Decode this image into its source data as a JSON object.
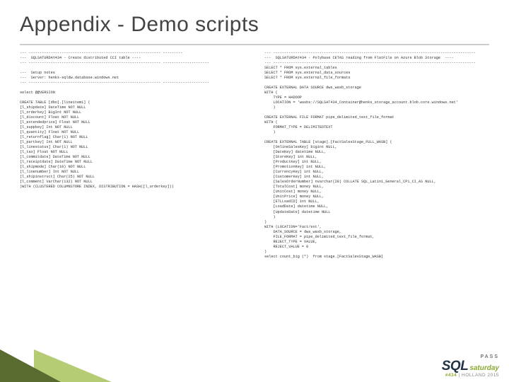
{
  "title": "Appendix -  Demo scripts",
  "left": {
    "lines": [
      "--- ------------------------------------------------------------ ---------",
      "---  SQLSATURDAY434 - Create distributed CCI table ----",
      "--- ------------------------------------------------------------ ---------------------",
      "",
      "---  Setup notes",
      "---  Server: henks-sqldw.database.windows.net",
      "--- ------------------------------------------------------------ ---------------------",
      "",
      "select @@VERSION",
      "",
      "CREATE TABLE [dbo].[lineitem1] (",
      "[l_shipdate] DateTime NOT NULL",
      "[l_orderkey] BigInt NOT NULL",
      "[l_discount] Float NOT NULL",
      "[l_extendedprice] Float NOT NULL",
      "[l_suppkey] Int NOT NULL",
      "[l_quantity] Float NOT NULL",
      "[l_returnflag] Char(1) NOT NULL",
      "[l_partkey] Int NOT NULL",
      "[l_linestatus] Char(1) NOT NULL",
      "[l_tax] Float NOT NULL",
      "[l_commitdate] DateTime NOT NULL",
      "[l_receiptdate] DateTime NOT NULL",
      "[l_shipmode] Char(10) NOT NULL",
      "[l_linenumber] Int NOT NULL",
      "[l_shipinstruct] Char(25) NOT NULL",
      "[l_comment] VarChar(132) NOT NULL",
      ")WITH (CLUSTERED COLUMNSTORE INDEX, DISTRIBUTION = HASH([l_orderkey]))"
    ]
  },
  "right": {
    "lines": [
      "--- --------------------------------------------------------------------------------------------",
      "---  SQLSATURDAY434 - Polybase CETAS reading from FlatFile on Azure Blob Storage  ----",
      "--- --------------------------------------------------------------------------------------------",
      "SELECT * FROM sys.external_tables",
      "SELECT * FROM sys.external_data_sources",
      "SELECT * FROM sys.external_file_formats",
      "",
      "CREATE EXTERNAL DATA SOURCE dws_wasb_storage",
      "WITH (",
      "    TYPE = HADOOP",
      "    LOCATION = 'wasbs://SQLSAT434_Container@henks_storage_account.blob.core.windows.net'",
      "    )",
      "",
      "CREATE EXTERNAL FILE FORMAT pipe_delimited_text_file_format",
      "WITH (",
      "    FORMAT_TYPE = DELIMITEDTEXT",
      "    )",
      "",
      "CREATE EXTERNAL TABLE [stage].[FactSalesStage_FULL_WASB] (",
      "    [OnlineSalesKey] bigint NULL,",
      "    [DateKey] datetime NULL,",
      "    [StoreKey] int NULL,",
      "    [ProductKey] int NULL,",
      "    [PromotionKey] int NULL,",
      "    [CurrencyKey] int NULL,",
      "    [CustomerKey] int NULL,",
      "    [SalesOrderNumber] nvarchar(28) COLLATE SQL_Latin1_General_CP1_CI_AS NULL,",
      "    [TotalCost] money NULL,",
      "    [UnitCost] money NULL,",
      "    [UnitPrice] money NULL,",
      "    [ETLLoadID] int NULL,",
      "    [LoadDate] datetime NULL,",
      "    [UpdateDate] datetime NULL",
      "    )",
      ")",
      "WITH (LOCATION='Fact/ext',",
      "    DATA_SOURCE = dws_wasb_storage,",
      "    FILE_FORMAT = pipe_delimited_text_file_format,",
      "    REJECT_TYPE = VALUE,",
      "    REJECT_VALUE = 0",
      ")",
      "select count_big (*)  from stage.[FactSalesStage_WASB]"
    ]
  },
  "footer": {
    "brand_top": "PASS",
    "brand_sql": "SQL",
    "brand_sat": "saturday",
    "tag_num": "#434",
    "tag_rest": " | HOLLAND 2015"
  }
}
